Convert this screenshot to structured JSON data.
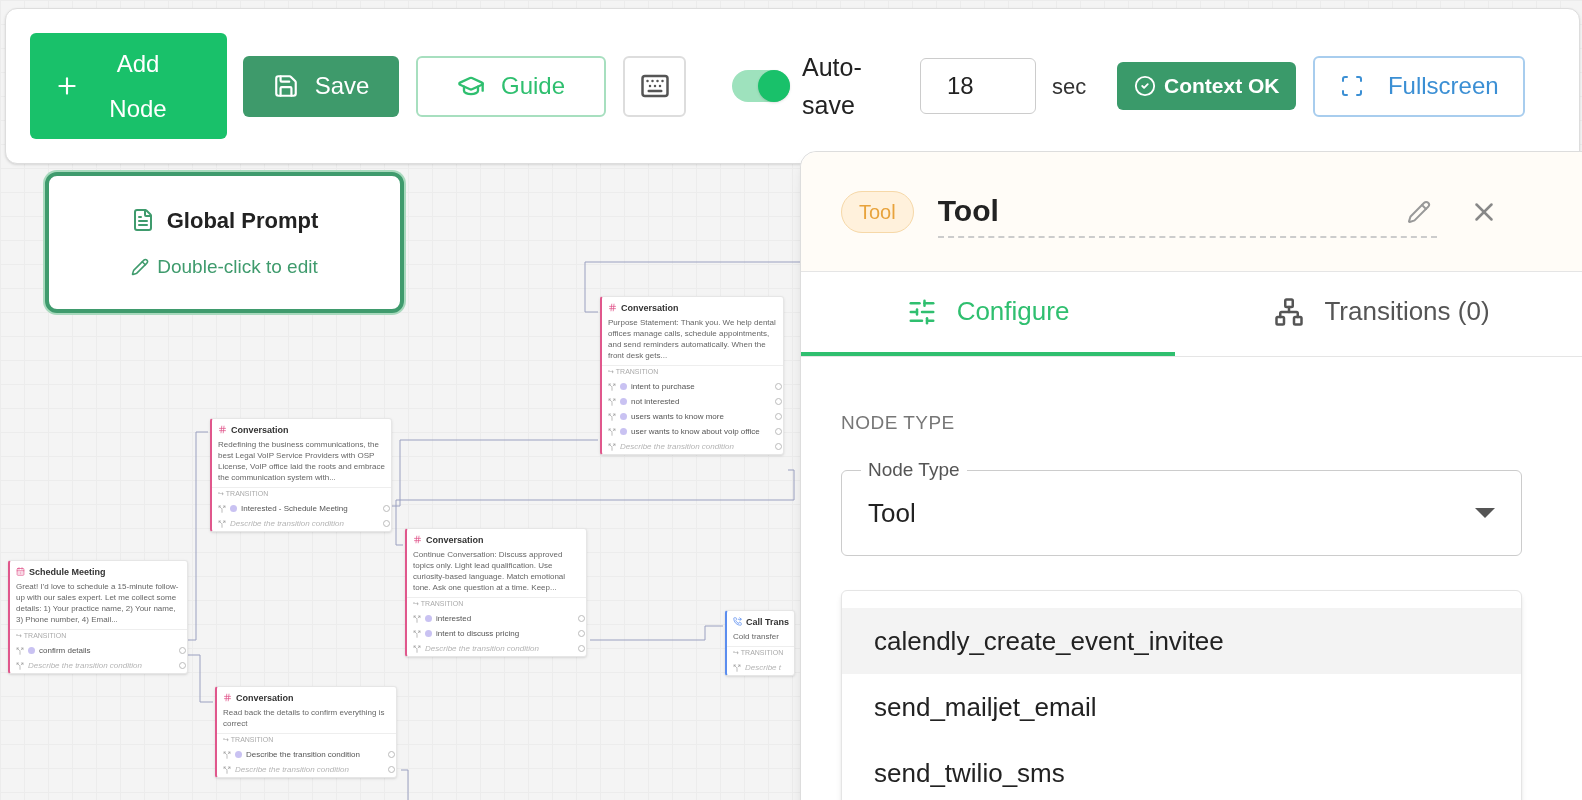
{
  "toolbar": {
    "add_node": "Add Node",
    "save": "Save",
    "guide": "Guide",
    "autosave": {
      "label": "Auto-save",
      "on": true
    },
    "interval": {
      "value": "18",
      "unit": "sec"
    },
    "context_status": "Context OK",
    "fullscreen": "Fullscreen"
  },
  "global_prompt": {
    "title": "Global Prompt",
    "hint": "Double-click to edit"
  },
  "nodes": [
    {
      "kind": "conversation",
      "title": "Conversation",
      "description": "Purpose Statement: Thank you. We help dental offices manage calls, schedule appointments, and send reminders automatically. When the front desk gets...",
      "transition_heading": "↪ TRANSITION",
      "transitions": [
        {
          "kind": "condition",
          "label": "intent to purchase"
        },
        {
          "kind": "condition",
          "label": "not interested"
        },
        {
          "kind": "condition",
          "label": "users wants to know more"
        },
        {
          "kind": "condition",
          "label": "user wants to know about voip office"
        },
        {
          "kind": "placeholder",
          "label": "Describe the transition condition"
        }
      ]
    },
    {
      "kind": "conversation",
      "title": "Conversation",
      "description": "Redefining the business communications, the best Legal VoIP Service Providers with OSP License, VoIP office laid the roots and embrace the communication system with...",
      "transition_heading": "↪ TRANSITION",
      "transitions": [
        {
          "kind": "condition",
          "label": "Interested - Schedule Meeting"
        },
        {
          "kind": "placeholder",
          "label": "Describe the transition condition"
        }
      ]
    },
    {
      "kind": "schedule",
      "title": "Schedule Meeting",
      "description": "Great! I'd love to schedule a 15-minute follow-up with our sales expert. Let me collect some details: 1) Your practice name, 2) Your name, 3) Phone number, 4) Email...",
      "transition_heading": "↪ TRANSITION",
      "transitions": [
        {
          "kind": "condition",
          "label": "confirm details"
        },
        {
          "kind": "placeholder",
          "label": "Describe the transition condition"
        }
      ]
    },
    {
      "kind": "conversation",
      "title": "Conversation",
      "description": "Continue Conversation: Discuss approved topics only. Light lead qualification. Use curiosity-based language. Match emotional tone. Ask one question at a time. Keep...",
      "transition_heading": "↪ TRANSITION",
      "transitions": [
        {
          "kind": "condition",
          "label": "interested"
        },
        {
          "kind": "condition",
          "label": "intent to discuss pricing"
        },
        {
          "kind": "placeholder",
          "label": "Describe the transition condition"
        }
      ]
    },
    {
      "kind": "conversation",
      "title": "Conversation",
      "description": "Read back the details to confirm everything is correct",
      "transition_heading": "↪ TRANSITION",
      "transitions": [
        {
          "kind": "condition",
          "label": "Describe the transition condition"
        },
        {
          "kind": "placeholder",
          "label": "Describe the transition condition"
        }
      ]
    },
    {
      "kind": "transfer",
      "title": "Call Trans",
      "description": "Cold transfer",
      "transition_heading": "↪ TRANSITION",
      "transitions": [
        {
          "kind": "placeholder",
          "label": "Describe t"
        }
      ]
    }
  ],
  "panel": {
    "badge": "Tool",
    "title": "Tool",
    "tabs": [
      {
        "label": "Configure",
        "selected": true
      },
      {
        "label": "Transitions (0)",
        "selected": false
      }
    ],
    "section": "NODE TYPE",
    "node_type": {
      "label": "Node Type",
      "value": "Tool"
    },
    "options": [
      {
        "label": "calendly_create_event_invitee",
        "selected": true
      },
      {
        "label": "send_mailjet_email",
        "selected": false
      },
      {
        "label": "send_twilio_sms",
        "selected": false
      }
    ]
  }
}
